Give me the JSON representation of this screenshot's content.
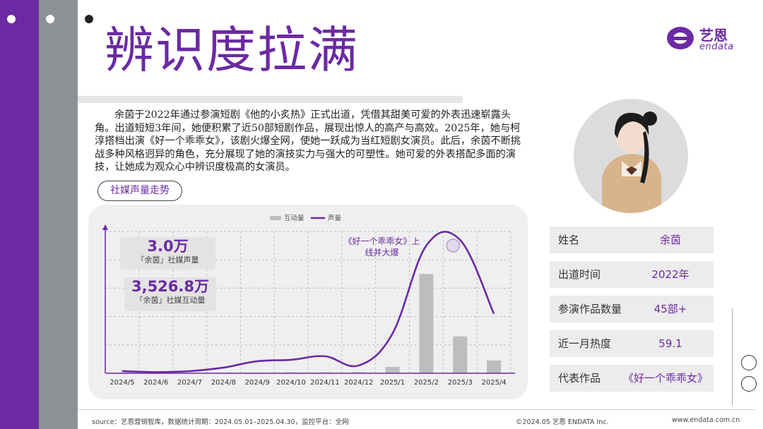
{
  "page": {
    "title": "辨识度拉满",
    "colors": {
      "accent": "#6b2aa3",
      "gray_strip": "#8e9194",
      "bar_gray": "#bdbdbd",
      "line_purple": "#6b2aa3"
    }
  },
  "logo": {
    "cn": "艺恩",
    "en": "endata",
    "icon": "endata-logo-icon"
  },
  "intro": "余茵于2022年通过参演短剧《他的小炙热》正式出道，凭借其甜美可爱的外表迅速崭露头角。出道短短3年间，她便积累了近50部短剧作品，展现出惊人的高产与高效。2025年，她与柯淳搭档出演《好一个乖乖女》，该剧火爆全网，使她一跃成为当红短剧女演员。此后，余茵不断挑战多种风格迥异的角色，充分展现了她的演技实力与强大的可塑性。她可爱的外表搭配多面的演技，让她成为观众心中辨识度极高的女演员。",
  "section_pill": "社媒声量走势",
  "stats": [
    {
      "value": "3.0万",
      "label": "「余茵」社媒声量"
    },
    {
      "value": "3,526.8万",
      "label": "「余茵」社媒互动量"
    }
  ],
  "annotation": {
    "line1": "《好一个乖乖女》上",
    "line2": "线并大爆"
  },
  "chart_data": {
    "type": "bar",
    "legend": [
      "互动量",
      "声量"
    ],
    "legend_position": "top-center",
    "categories": [
      "2024/5",
      "2024/6",
      "2024/7",
      "2024/8",
      "2024/9",
      "2024/10",
      "2024/11",
      "2024/12",
      "2025/1",
      "2025/2",
      "2025/3",
      "2025/4"
    ],
    "series": [
      {
        "name": "互动量",
        "type": "bar",
        "values": [
          0.5,
          0.3,
          0.3,
          0.4,
          0.5,
          0.6,
          0.6,
          0.8,
          4.5,
          70,
          26,
          9
        ]
      },
      {
        "name": "声量",
        "type": "line",
        "values": [
          1.5,
          0.8,
          1.5,
          4,
          8.5,
          9.5,
          12,
          5.5,
          28,
          90,
          94,
          42
        ]
      }
    ],
    "ylim": [
      0,
      100
    ],
    "grid": true,
    "y_axis_labels": false
  },
  "profile": {
    "avatar": "avatar",
    "rows": [
      {
        "label": "姓名",
        "value": "余茵"
      },
      {
        "label": "出道时间",
        "value": "2022年"
      },
      {
        "label": "参演作品数量",
        "value": "45部+"
      },
      {
        "label": "近一月热度",
        "value": "59.1"
      },
      {
        "label": "代表作品",
        "value": "《好一个乖乖女》"
      }
    ]
  },
  "footer": {
    "source": "source：艺恩营销智库，数据统计周期：2024.05.01–2025.04.30，监控平台：全网",
    "copyright": "©2024.05  艺恩 ENDATA Inc.",
    "website": "www.endata.com.cn"
  }
}
